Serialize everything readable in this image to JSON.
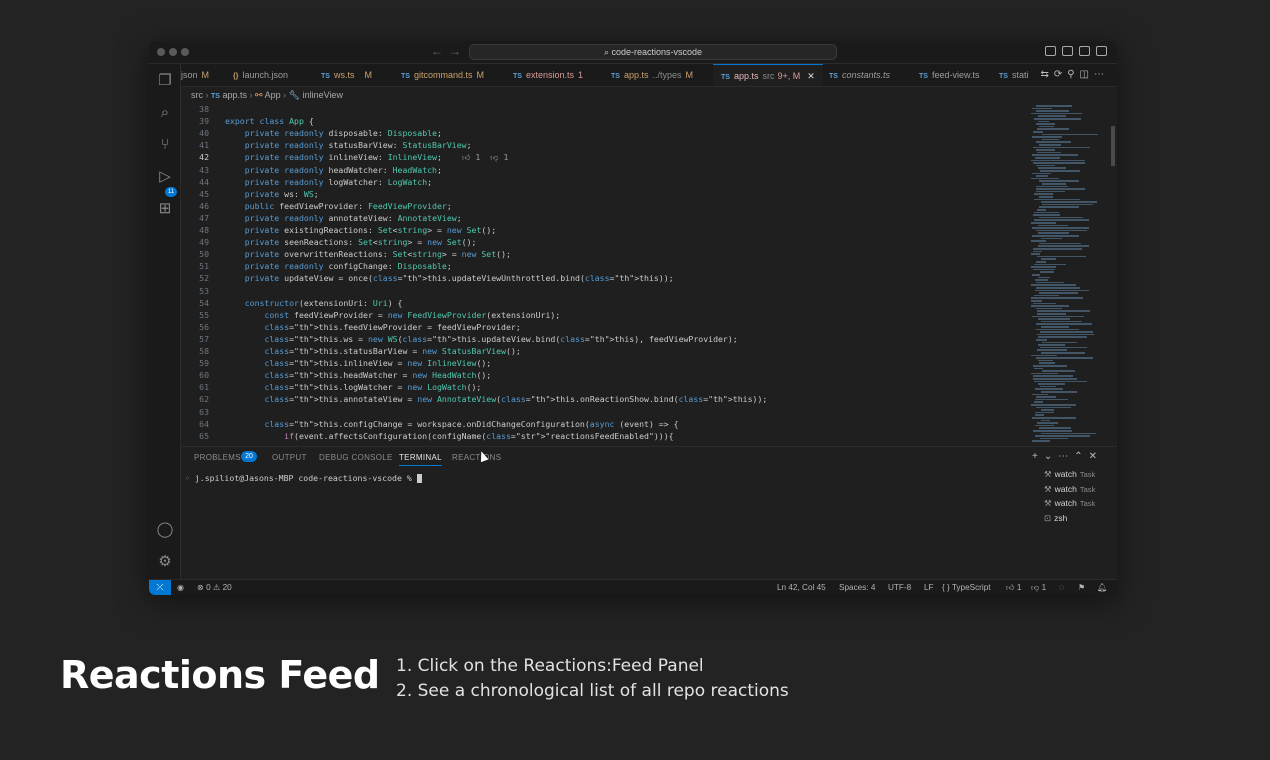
{
  "window": {
    "search_text": "code-reactions-vscode"
  },
  "tabs": [
    {
      "name": "json",
      "label": "json",
      "status": "M",
      "lang": ""
    },
    {
      "name": "launch",
      "label": "launch.json",
      "status": "",
      "lang": "{}"
    },
    {
      "name": "ws",
      "label": "ws.ts",
      "status": "M",
      "lang": "TS"
    },
    {
      "name": "gitcommand",
      "label": "gitcommand.ts",
      "status": "M",
      "lang": "TS"
    },
    {
      "name": "extension",
      "label": "extension.ts",
      "status": "1",
      "lang": "TS"
    },
    {
      "name": "app-types",
      "label": "app.ts",
      "detail": "../types",
      "status": "M",
      "lang": "TS"
    },
    {
      "name": "app-src",
      "label": "app.ts",
      "detail": "src",
      "status": "9+, M",
      "lang": "TS",
      "active": true
    },
    {
      "name": "constants",
      "label": "constants.ts",
      "status": "",
      "lang": "TS"
    },
    {
      "name": "feed-view",
      "label": "feed-view.ts",
      "status": "",
      "lang": "TS"
    },
    {
      "name": "stat",
      "label": "stati",
      "status": "",
      "lang": "TS"
    }
  ],
  "breadcrumb": {
    "src": "src",
    "file": "app.ts",
    "class": "App",
    "member": "inlineView"
  },
  "inline_reactions": {
    "thumbs_up": "1",
    "thumbs_down": "1"
  },
  "code_lines": [
    {
      "n": "38",
      "text": ""
    },
    {
      "n": "39",
      "text": "export class App {"
    },
    {
      "n": "40",
      "text": "    private readonly disposable: Disposable;"
    },
    {
      "n": "41",
      "text": "    private readonly statusBarView: StatusBarView;"
    },
    {
      "n": "42",
      "text": "    private readonly inlineView: InlineView;"
    },
    {
      "n": "43",
      "text": "    private readonly headWatcher: HeadWatch;"
    },
    {
      "n": "44",
      "text": "    private readonly logWatcher: LogWatch;"
    },
    {
      "n": "45",
      "text": "    private ws: WS;"
    },
    {
      "n": "46",
      "text": "    public feedViewProvider: FeedViewProvider;"
    },
    {
      "n": "47",
      "text": "    private readonly annotateView: AnnotateView;"
    },
    {
      "n": "48",
      "text": "    private existingReactions: Set<string> = new Set();"
    },
    {
      "n": "49",
      "text": "    private seenReactions: Set<string> = new Set();"
    },
    {
      "n": "50",
      "text": "    private overwrittenReactions: Set<string> = new Set();"
    },
    {
      "n": "51",
      "text": "    private readonly configChange: Disposable;"
    },
    {
      "n": "52",
      "text": "    private updateView = once(this.updateViewUnthrottled.bind(this));"
    },
    {
      "n": "53",
      "text": ""
    },
    {
      "n": "54",
      "text": "    constructor(extensionUri: Uri) {"
    },
    {
      "n": "55",
      "text": "        const feedViewProvider = new FeedViewProvider(extensionUri);"
    },
    {
      "n": "56",
      "text": "        this.feedViewProvider = feedViewProvider;"
    },
    {
      "n": "57",
      "text": "        this.ws = new WS(this.updateView.bind(this), feedViewProvider);"
    },
    {
      "n": "58",
      "text": "        this.statusBarView = new StatusBarView();"
    },
    {
      "n": "59",
      "text": "        this.inlineView = new InlineView();"
    },
    {
      "n": "60",
      "text": "        this.headWatcher = new HeadWatch();"
    },
    {
      "n": "61",
      "text": "        this.logWatcher = new LogWatch();"
    },
    {
      "n": "62",
      "text": "        this.annotateView = new AnnotateView(this.onReactionShow.bind(this));"
    },
    {
      "n": "63",
      "text": ""
    },
    {
      "n": "64",
      "text": "        this.configChange = workspace.onDidChangeConfiguration(async (event) => {"
    },
    {
      "n": "65",
      "text": "            if(event.affectsConfiguration(configName(\"reactionsFeedEnabled\"))){"
    }
  ],
  "panel": {
    "tabs": [
      "PROBLEMS",
      "OUTPUT",
      "DEBUG CONSOLE",
      "TERMINAL",
      "REACTIONS"
    ],
    "problems_count": "20",
    "prompt": "j.spiliot@Jasons-MBP code-reactions-vscode %",
    "terminals": [
      {
        "name": "watch",
        "sub": "Task"
      },
      {
        "name": "watch",
        "sub": "Task"
      },
      {
        "name": "watch",
        "sub": "Task"
      },
      {
        "name": "zsh",
        "sub": ""
      }
    ]
  },
  "status_bar": {
    "errors": "0",
    "warnings": "20",
    "position": "Ln 42, Col 45",
    "spaces": "Spaces: 4",
    "encoding": "UTF-8",
    "eol": "LF",
    "language": "TypeScript",
    "up": "1",
    "down": "1"
  },
  "caption": {
    "title": "Reactions Feed",
    "step1": "1. Click on the Reactions:Feed Panel",
    "step2": "2. See a chronological list of all repo reactions"
  }
}
